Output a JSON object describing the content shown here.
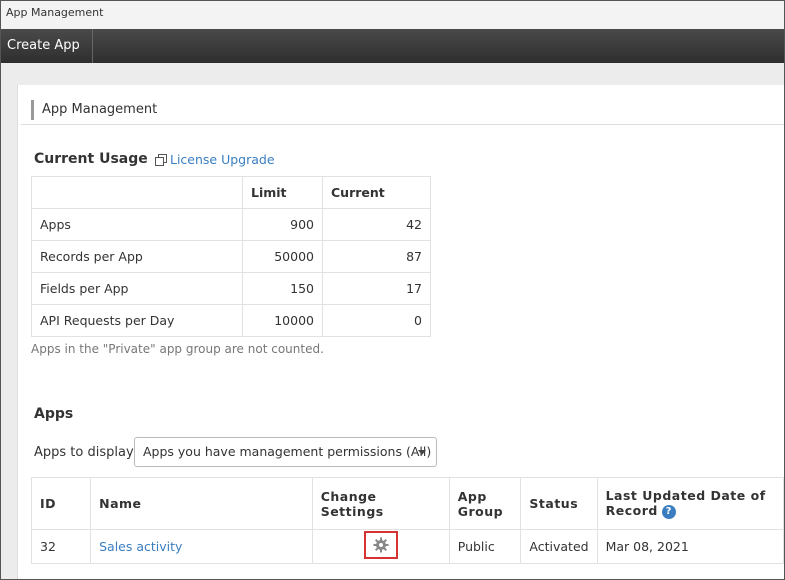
{
  "window": {
    "title": "App Management"
  },
  "toolbar": {
    "create_app": "Create App"
  },
  "section": {
    "title": "App Management"
  },
  "usage": {
    "heading": "Current Usage",
    "upgrade_link": "License Upgrade",
    "columns": [
      "",
      "Limit",
      "Current"
    ],
    "rows": [
      {
        "label": "Apps",
        "limit": "900",
        "current": "42"
      },
      {
        "label": "Records per App",
        "limit": "50000",
        "current": "87"
      },
      {
        "label": "Fields per App",
        "limit": "150",
        "current": "17"
      },
      {
        "label": "API Requests per Day",
        "limit": "10000",
        "current": "0"
      }
    ],
    "note": "Apps in the \"Private\" app group are not counted."
  },
  "apps": {
    "heading": "Apps",
    "display_label": "Apps to display",
    "display_value": "Apps you have management permissions (All)",
    "columns": {
      "id": "ID",
      "name": "Name",
      "change_settings": "Change Settings",
      "app_group": "App Group",
      "status": "Status",
      "last_updated": "Last Updated Date of Record"
    },
    "rows": [
      {
        "id": "32",
        "name": "Sales activity",
        "app_group": "Public",
        "status": "Activated",
        "last_updated": "Mar 08, 2021"
      }
    ]
  },
  "icons": {
    "settings": "gear-icon",
    "help": "help-icon",
    "external": "open-window-icon"
  },
  "colors": {
    "link": "#3a7ec1",
    "highlight": "#d63232",
    "toolbar": "#3a3a3a"
  }
}
